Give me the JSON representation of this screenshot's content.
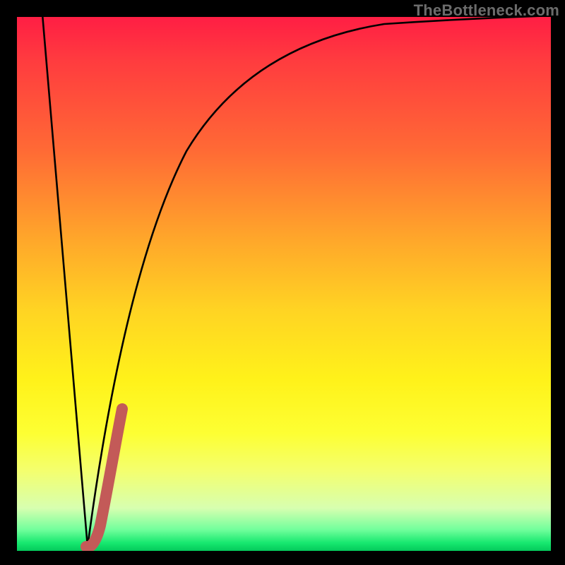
{
  "attribution": "TheBottleneck.com",
  "colors": {
    "frame": "#000000",
    "curve": "#000000",
    "highlight": "#c35a58",
    "gradient_top": "#ff1e44",
    "gradient_mid": "#ffe81a",
    "gradient_bottom": "#04c95b",
    "attribution_text": "#6c6c6c"
  },
  "chart_data": {
    "type": "line",
    "title": "",
    "xlabel": "",
    "ylabel": "",
    "xlim": [
      0,
      100
    ],
    "ylim": [
      0,
      100
    ],
    "series": [
      {
        "name": "left-descent",
        "x": [
          5,
          13
        ],
        "y": [
          100,
          1
        ]
      },
      {
        "name": "recovery-curve",
        "x": [
          13,
          20,
          32,
          45,
          60,
          80,
          100
        ],
        "y": [
          1,
          52,
          75,
          88,
          95,
          98.5,
          100
        ]
      },
      {
        "name": "highlighted-segment",
        "x": [
          13,
          15,
          17,
          19.5
        ],
        "y": [
          1,
          5,
          12,
          27
        ]
      }
    ],
    "background": {
      "kind": "vertical-gradient",
      "stops": [
        {
          "pos": 0.0,
          "color": "#04c95b"
        },
        {
          "pos": 0.03,
          "color": "#72ff9c"
        },
        {
          "pos": 0.1,
          "color": "#d7ffb0"
        },
        {
          "pos": 0.22,
          "color": "#fdff33"
        },
        {
          "pos": 0.45,
          "color": "#ffd423"
        },
        {
          "pos": 0.7,
          "color": "#ff6a35"
        },
        {
          "pos": 1.0,
          "color": "#ff1e44"
        }
      ]
    }
  }
}
